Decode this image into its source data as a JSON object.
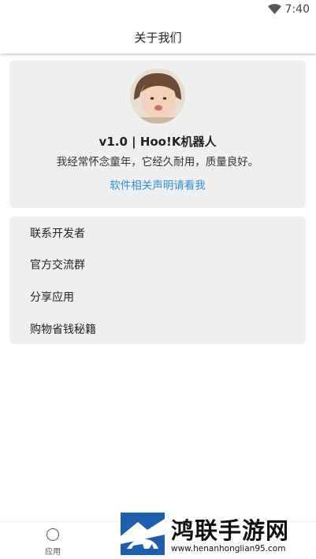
{
  "status_bar": {
    "time": "7:40",
    "icons": [
      "wifi-icon"
    ]
  },
  "app_bar": {
    "title": "关于我们"
  },
  "about": {
    "avatar": "avatar-photo",
    "version": "v1.0 | Hoo!K机器人",
    "slogan": "我经常怀念童年，它经久耐用，质量良好。",
    "statement_link": "软件相关声明请看我"
  },
  "menu": {
    "items": [
      {
        "label": "联系开发者"
      },
      {
        "label": "官方交流群"
      },
      {
        "label": "分享应用"
      },
      {
        "label": "购物省钱秘籍"
      }
    ]
  },
  "bottom_nav": {
    "items": [
      {
        "label": "应用",
        "icon": "circle-icon"
      }
    ]
  },
  "watermark": {
    "title": "鸿联手游网",
    "url": "www.henanhonglian95.com",
    "brand_color": "#1f5fae"
  }
}
